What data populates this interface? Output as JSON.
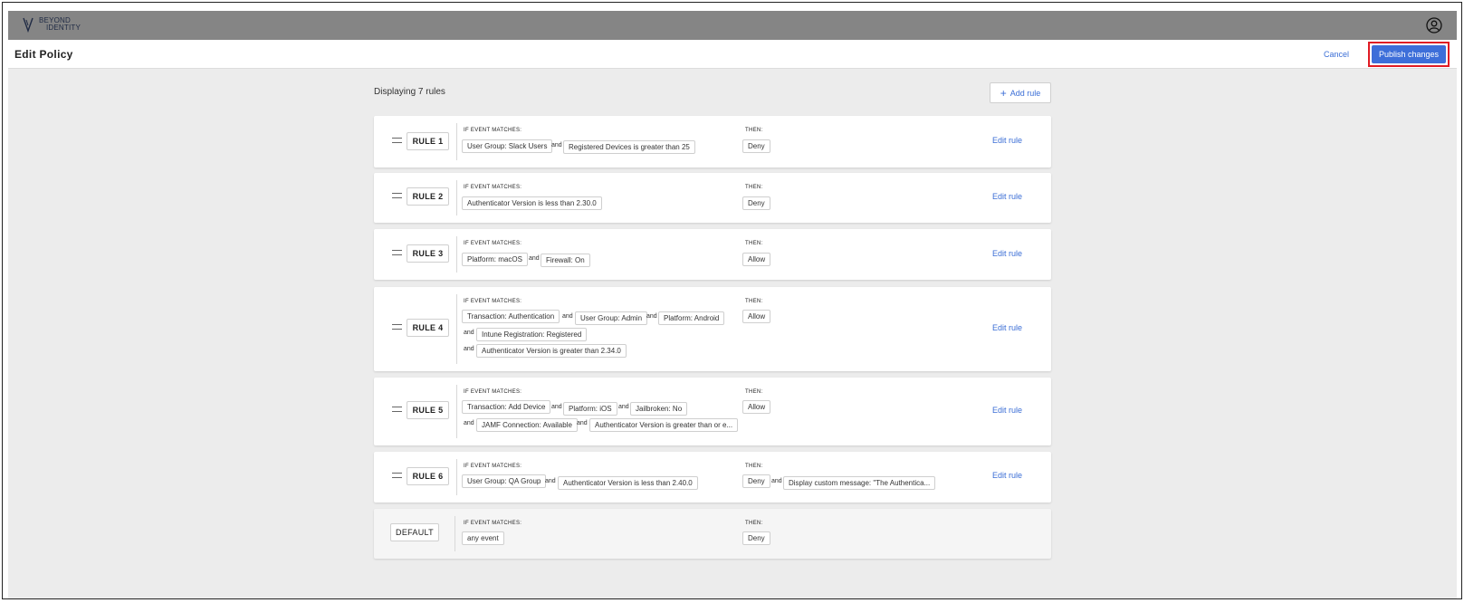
{
  "brand": {
    "line1": "BEYOND",
    "line2": "IDENTITY"
  },
  "header": {
    "title": "Edit Policy",
    "cancel_label": "Cancel",
    "publish_label": "Publish changes"
  },
  "main": {
    "displaying": "Displaying 7 rules",
    "add_rule_label": "Add rule"
  },
  "labels": {
    "if": "IF EVENT MATCHES:",
    "then": "THEN:",
    "and": "and",
    "edit": "Edit rule"
  },
  "rules": [
    {
      "name": "RULE 1",
      "conditions": [
        "User Group: Slack Users",
        "Registered Devices is greater than 25"
      ],
      "actions": [
        "Deny"
      ]
    },
    {
      "name": "RULE 2",
      "conditions": [
        "Authenticator Version is less than 2.30.0"
      ],
      "actions": [
        "Deny"
      ]
    },
    {
      "name": "RULE 3",
      "conditions": [
        "Platform: macOS",
        "Firewall: On"
      ],
      "actions": [
        "Allow"
      ]
    },
    {
      "name": "RULE 4",
      "conditions": [
        "Transaction: Authentication",
        "User Group: Admin",
        "Platform: Android",
        "Intune Registration: Registered",
        "Authenticator Version is greater than 2.34.0"
      ],
      "actions": [
        "Allow"
      ]
    },
    {
      "name": "RULE 5",
      "conditions": [
        "Transaction: Add Device",
        "Platform: iOS",
        "Jailbroken: No",
        "JAMF Connection: Available",
        "Authenticator Version is greater than or e..."
      ],
      "actions": [
        "Allow"
      ]
    },
    {
      "name": "RULE 6",
      "conditions": [
        "User Group: QA Group",
        "Authenticator Version is less than 2.40.0"
      ],
      "actions": [
        "Deny",
        "Display custom message: \"The Authentica..."
      ]
    },
    {
      "name": "DEFAULT",
      "conditions": [
        "any event"
      ],
      "actions": [
        "Deny"
      ]
    }
  ],
  "colors": {
    "accent": "#3d6ed9",
    "topbar": "#858585",
    "highlight": "#e01b24",
    "background": "#ececec"
  }
}
